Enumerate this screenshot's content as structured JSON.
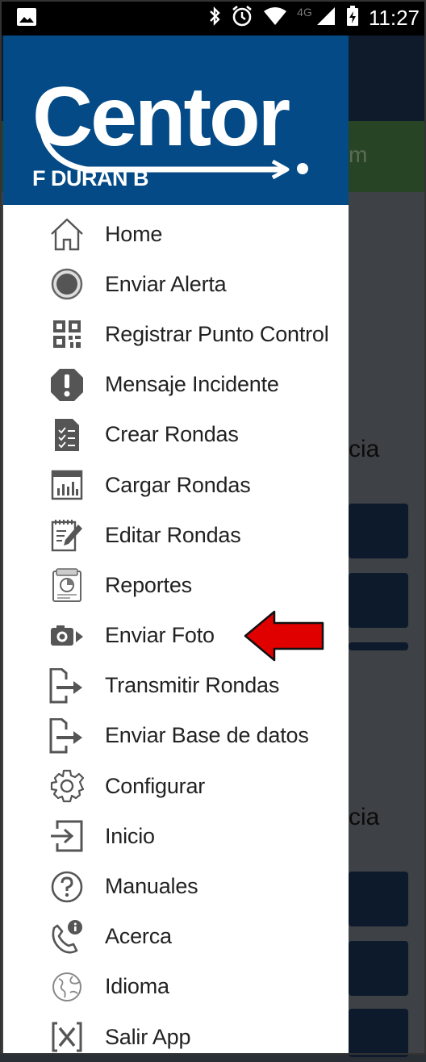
{
  "status_bar": {
    "time": "11:27",
    "network": "4G"
  },
  "drawer": {
    "logo_text": "Centor",
    "user_name": "F DURAN B",
    "menu": [
      {
        "label": "Home",
        "icon": "home-icon"
      },
      {
        "label": "Enviar Alerta",
        "icon": "alert-record-icon"
      },
      {
        "label": "Registrar Punto Control",
        "icon": "qr-code-icon"
      },
      {
        "label": "Mensaje Incidente",
        "icon": "exclamation-icon"
      },
      {
        "label": "Crear Rondas",
        "icon": "checklist-document-icon"
      },
      {
        "label": "Cargar Rondas",
        "icon": "calendar-chart-icon"
      },
      {
        "label": "Editar Rondas",
        "icon": "edit-notepad-icon"
      },
      {
        "label": "Reportes",
        "icon": "report-chart-icon"
      },
      {
        "label": "Enviar Foto",
        "icon": "camera-icon"
      },
      {
        "label": "Transmitir Rondas",
        "icon": "file-export-icon"
      },
      {
        "label": "Enviar Base de datos",
        "icon": "file-export-icon"
      },
      {
        "label": "Configurar",
        "icon": "gear-icon"
      },
      {
        "label": "Inicio",
        "icon": "login-icon"
      },
      {
        "label": "Manuales",
        "icon": "help-circle-icon"
      },
      {
        "label": "Acerca",
        "icon": "phone-info-icon"
      },
      {
        "label": "Idioma",
        "icon": "globe-icon"
      },
      {
        "label": "Salir App",
        "icon": "exit-x-icon"
      }
    ]
  },
  "background": {
    "fragment_1": "m",
    "fragment_2": "cia",
    "fragment_3": "cia"
  },
  "colors": {
    "drawer_header": "#034a86",
    "arrow": "#e00000"
  }
}
